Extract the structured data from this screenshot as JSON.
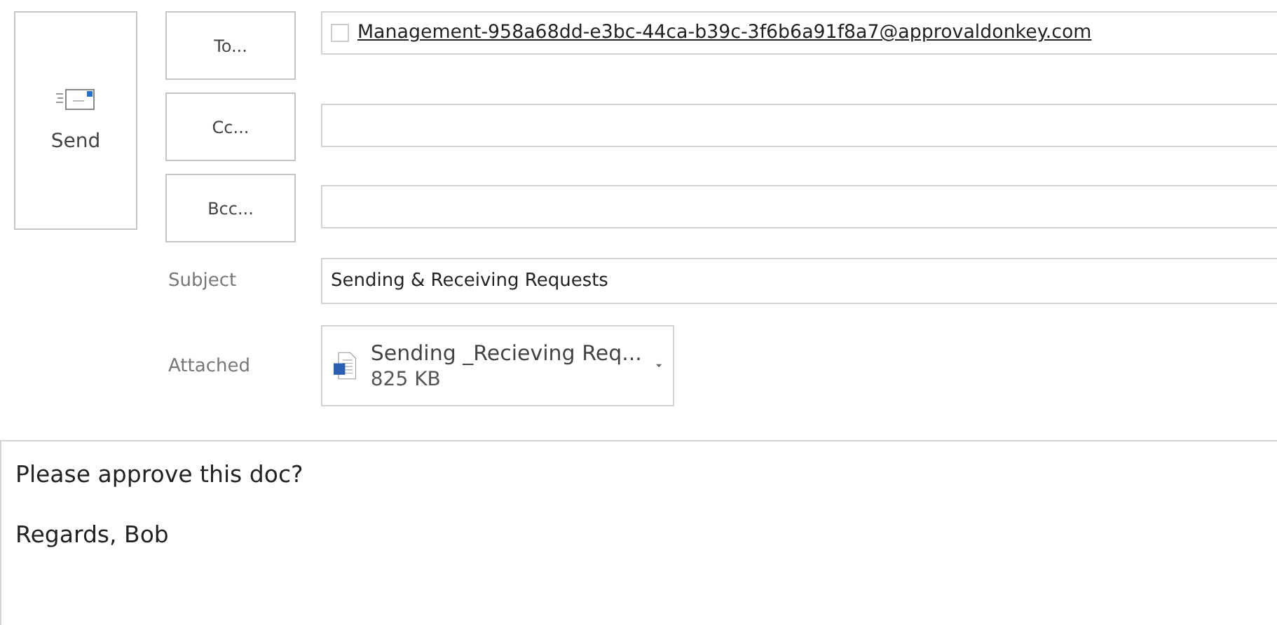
{
  "send_button": {
    "label": "Send"
  },
  "recipients": [
    {
      "button": "To...",
      "recipient": {
        "address": "Management-958a68dd-e3bc-44ca-b39c-3f6b6a91f8a7@approvaldonkey.com",
        "checked": false
      }
    },
    {
      "button": "Cc..."
    },
    {
      "button": "Bcc..."
    }
  ],
  "subject": {
    "label": "Subject",
    "value": "Sending & Receiving Requests"
  },
  "attached": {
    "label": "Attached",
    "file": {
      "name": "Sending _Recieving Req...",
      "size": "825 KB"
    }
  },
  "body": [
    "Please approve this doc?",
    "Regards, Bob"
  ]
}
